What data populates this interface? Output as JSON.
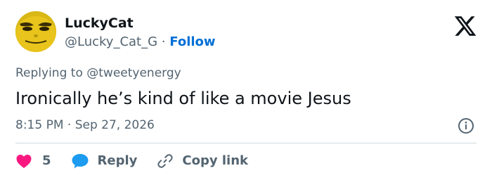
{
  "author": {
    "name": "LuckyCat",
    "handle": "@Lucky_Cat_G",
    "separator": "·",
    "follow_label": "Follow",
    "avatar_icon": "yellow-face-avatar"
  },
  "platform_icon": "x-logo-icon",
  "reply_context": {
    "prefix": "Replying to",
    "target": "@tweetyenergy"
  },
  "text": "Ironically he’s kind of like a movie Jesus",
  "timestamp": {
    "time": "8:15 PM",
    "separator": "·",
    "date": "Sep 27, 2026"
  },
  "info_icon": "info-icon",
  "actions": {
    "like_count": "5",
    "reply_label": "Reply",
    "copy_label": "Copy link"
  },
  "colors": {
    "text": "#0f1419",
    "secondary": "#536471",
    "link": "#006fd6",
    "like": "#f91880",
    "reply": "#1d9bf0",
    "divider": "#cfd9de"
  }
}
